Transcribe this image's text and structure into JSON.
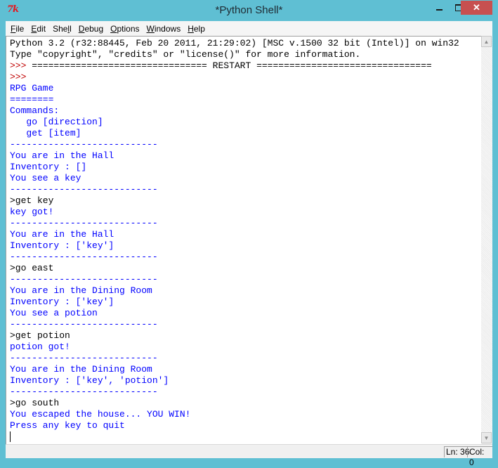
{
  "window": {
    "title": "*Python Shell*",
    "app_icon": "tk-feather-icon",
    "logo_text": "7k",
    "close_label": "✕"
  },
  "menu": [
    {
      "label": "File",
      "mnemonic_index": 0
    },
    {
      "label": "Edit",
      "mnemonic_index": 0
    },
    {
      "label": "Shell",
      "mnemonic_index": 3
    },
    {
      "label": "Debug",
      "mnemonic_index": 0
    },
    {
      "label": "Options",
      "mnemonic_index": 0
    },
    {
      "label": "Windows",
      "mnemonic_index": 0
    },
    {
      "label": "Help",
      "mnemonic_index": 0
    }
  ],
  "shell_lines": [
    {
      "type": "plain",
      "text": "Python 3.2 (r32:88445, Feb 20 2011, 21:29:02) [MSC v.1500 32 bit (Intel)] on win32"
    },
    {
      "type": "plain",
      "text": "Type \"copyright\", \"credits\" or \"license()\" for more information."
    },
    {
      "type": "restart",
      "prompt": ">>> ",
      "text": "================================ RESTART ================================"
    },
    {
      "type": "prompt",
      "prompt": ">>> ",
      "text": ""
    },
    {
      "type": "stdout",
      "text": "RPG Game"
    },
    {
      "type": "stdout",
      "text": "========"
    },
    {
      "type": "stdout",
      "text": "Commands:"
    },
    {
      "type": "stdout",
      "text": "   go [direction]"
    },
    {
      "type": "stdout",
      "text": "   get [item]"
    },
    {
      "type": "stdout",
      "text": "---------------------------"
    },
    {
      "type": "stdout",
      "text": "You are in the Hall"
    },
    {
      "type": "stdout",
      "text": "Inventory : []"
    },
    {
      "type": "stdout",
      "text": "You see a key"
    },
    {
      "type": "stdout",
      "text": "---------------------------"
    },
    {
      "type": "stdin",
      "text": ">get key"
    },
    {
      "type": "stdout",
      "text": "key got!"
    },
    {
      "type": "stdout",
      "text": "---------------------------"
    },
    {
      "type": "stdout",
      "text": "You are in the Hall"
    },
    {
      "type": "stdout",
      "text": "Inventory : ['key']"
    },
    {
      "type": "stdout",
      "text": "---------------------------"
    },
    {
      "type": "stdin",
      "text": ">go east"
    },
    {
      "type": "stdout",
      "text": "---------------------------"
    },
    {
      "type": "stdout",
      "text": "You are in the Dining Room"
    },
    {
      "type": "stdout",
      "text": "Inventory : ['key']"
    },
    {
      "type": "stdout",
      "text": "You see a potion"
    },
    {
      "type": "stdout",
      "text": "---------------------------"
    },
    {
      "type": "stdin",
      "text": ">get potion"
    },
    {
      "type": "stdout",
      "text": "potion got!"
    },
    {
      "type": "stdout",
      "text": "---------------------------"
    },
    {
      "type": "stdout",
      "text": "You are in the Dining Room"
    },
    {
      "type": "stdout",
      "text": "Inventory : ['key', 'potion']"
    },
    {
      "type": "stdout",
      "text": "---------------------------"
    },
    {
      "type": "stdin",
      "text": ">go south"
    },
    {
      "type": "stdout",
      "text": "You escaped the house... YOU WIN!"
    },
    {
      "type": "stdout",
      "text": "Press any key to quit"
    },
    {
      "type": "cursor",
      "text": ""
    }
  ],
  "colors": {
    "stdout": "#0000ff",
    "stdin": "#000000",
    "prompt": "#c00000",
    "titlebar": "#5fbfd3",
    "close_button": "#c75050"
  },
  "scrollbar": {
    "up_arrow": "▲",
    "down_arrow": "▼"
  },
  "status": {
    "line": "Ln: 36",
    "col": "Col: 0"
  }
}
